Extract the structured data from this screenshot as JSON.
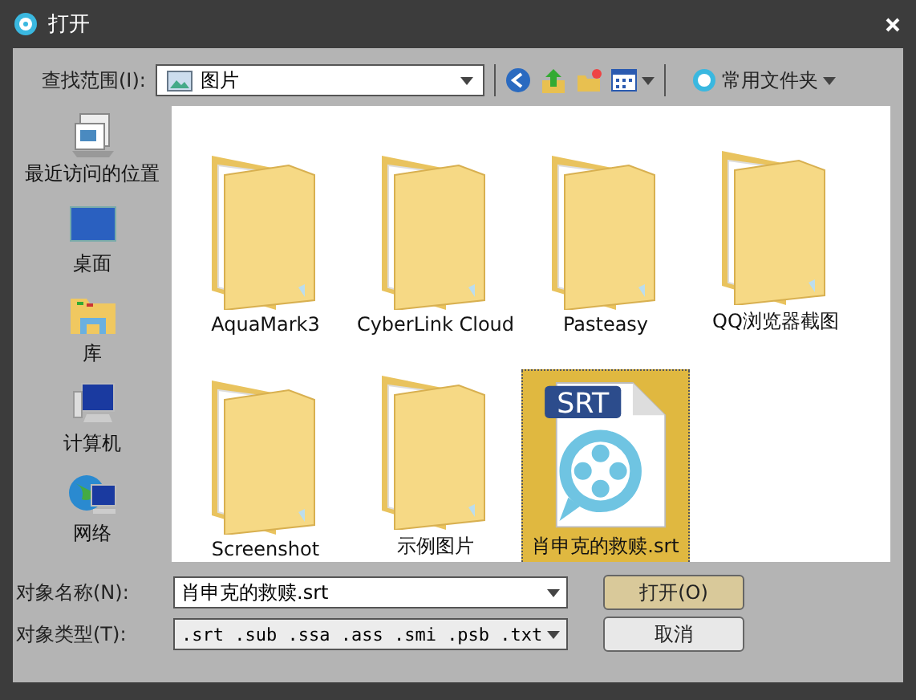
{
  "window": {
    "title": "打开"
  },
  "toolbar": {
    "look_in_label": "查找范围(I):",
    "look_in_value": "图片",
    "favorites": "常用文件夹"
  },
  "sidebar": {
    "items": [
      {
        "label": "最近访问的位置",
        "kind": "recent"
      },
      {
        "label": "桌面",
        "kind": "desktop"
      },
      {
        "label": "库",
        "kind": "library"
      },
      {
        "label": "计算机",
        "kind": "computer"
      },
      {
        "label": "网络",
        "kind": "network"
      }
    ]
  },
  "files": [
    {
      "name": "AquaMark3",
      "kind": "folder",
      "selected": false
    },
    {
      "name": "CyberLink Cloud",
      "kind": "folder",
      "selected": false
    },
    {
      "name": "Pasteasy",
      "kind": "folder",
      "selected": false
    },
    {
      "name": "QQ浏览器截图",
      "kind": "folder",
      "selected": false
    },
    {
      "name": "Screenshot",
      "kind": "folder",
      "selected": false
    },
    {
      "name": "示例图片",
      "kind": "folder",
      "selected": false
    },
    {
      "name": "肖申克的救赎.srt",
      "kind": "srt",
      "badge": "SRT",
      "selected": true
    }
  ],
  "file_name": {
    "label": "对象名称(N):",
    "value": "肖申克的救赎.srt"
  },
  "file_type": {
    "label": "对象类型(T):",
    "value": ".srt .sub .ssa .ass .smi .psb .txt"
  },
  "buttons": {
    "open": "打开(O)",
    "cancel": "取消"
  }
}
